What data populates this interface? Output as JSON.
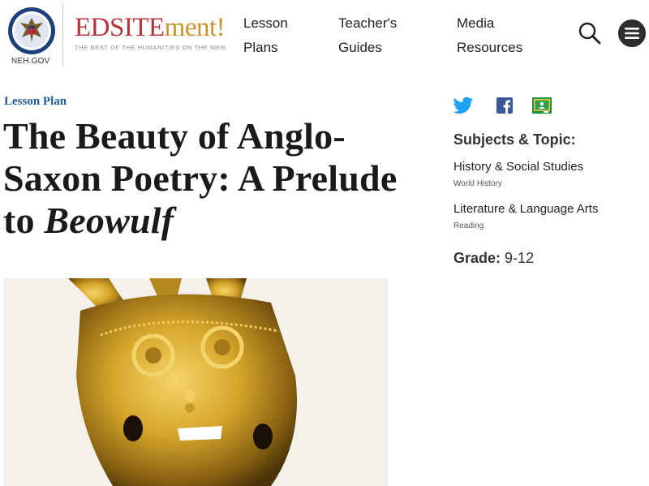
{
  "header": {
    "seal_label": "NEH.GOV",
    "brand_part1": "EDSITE",
    "brand_part2": "ment!",
    "tagline": "THE BEST OF THE HUMANITIES ON THE WEB",
    "nav": [
      {
        "line1": "Lesson",
        "line2": "Plans"
      },
      {
        "line1": "Teacher's",
        "line2": "Guides"
      },
      {
        "line1": "Media",
        "line2": "Resources"
      }
    ],
    "search_icon": "search-icon",
    "menu_icon": "hamburger-menu-icon"
  },
  "article": {
    "kicker": "Lesson Plan",
    "title_line1": "The Beauty of Anglo-",
    "title_line2": "Saxon Poetry: A Prelude",
    "title_line3_prefix": "to ",
    "title_line3_italic": "Beowulf"
  },
  "sidebar": {
    "share_icons": [
      "twitter-icon",
      "facebook-icon",
      "google-classroom-icon"
    ],
    "subjects_heading": "Subjects & Topic:",
    "subjects": [
      {
        "name": "History & Social Studies",
        "topic": "World History"
      },
      {
        "name": "Literature & Language Arts",
        "topic": "Reading"
      }
    ],
    "grade_label": "Grade:",
    "grade_value": "9-12"
  },
  "colors": {
    "brand_red": "#b3343c",
    "brand_gold": "#c8932c",
    "kicker_blue": "#1d5a9a",
    "twitter_blue": "#1da1f2",
    "facebook_blue": "#3b5998",
    "classroom_green": "#1e8e3e",
    "gold_artifact": "#c9a227"
  }
}
